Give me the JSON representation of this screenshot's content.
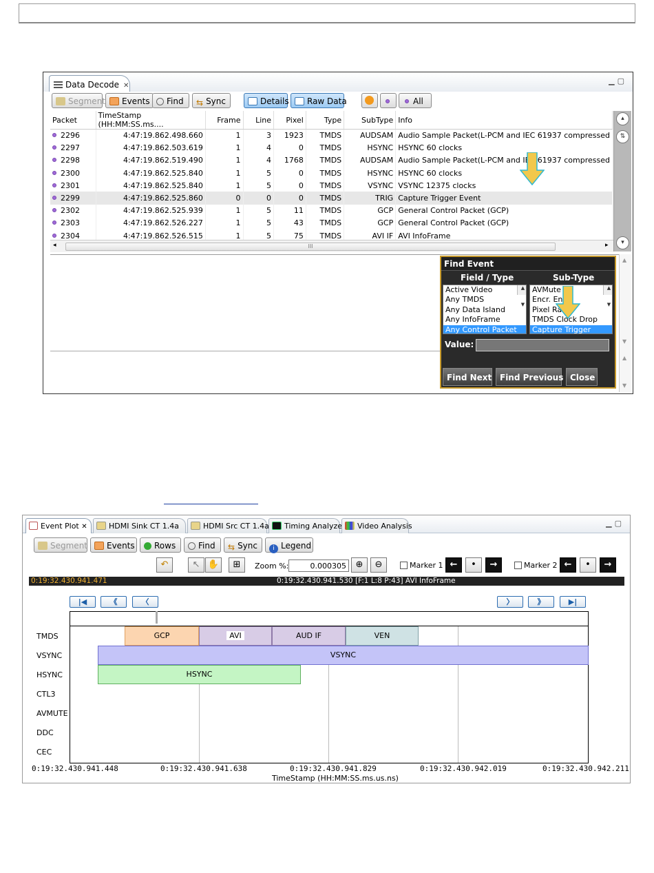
{
  "data_decode": {
    "tab_title": "Data Decode",
    "toolbar": {
      "segment": "Segment",
      "events": "Events",
      "find": "Find",
      "sync": "Sync",
      "details": "Details",
      "raw_data": "Raw Data",
      "all": "All"
    },
    "columns": [
      "Packet",
      "TimeStamp (HH:MM:SS.ms....",
      "Frame",
      "Line",
      "Pixel",
      "Type",
      "SubType",
      "Info"
    ],
    "rows": [
      {
        "packet": "2296",
        "timestamp": "4:47:19.862.498.660",
        "frame": "1",
        "line": "3",
        "pixel": "1923",
        "type": "TMDS",
        "subtype": "AUDSAM",
        "info": "Audio Sample Packet(L-PCM and IEC 61937 compressed"
      },
      {
        "packet": "2297",
        "timestamp": "4:47:19.862.503.619",
        "frame": "1",
        "line": "4",
        "pixel": "0",
        "type": "TMDS",
        "subtype": "HSYNC",
        "info": "HSYNC 60 clocks"
      },
      {
        "packet": "2298",
        "timestamp": "4:47:19.862.519.490",
        "frame": "1",
        "line": "4",
        "pixel": "1768",
        "type": "TMDS",
        "subtype": "AUDSAM",
        "info": "Audio Sample Packet(L-PCM and IEC 61937 compressed"
      },
      {
        "packet": "2300",
        "timestamp": "4:47:19.862.525.840",
        "frame": "1",
        "line": "5",
        "pixel": "0",
        "type": "TMDS",
        "subtype": "HSYNC",
        "info": "HSYNC 60 clocks"
      },
      {
        "packet": "2301",
        "timestamp": "4:47:19.862.525.840",
        "frame": "1",
        "line": "5",
        "pixel": "0",
        "type": "TMDS",
        "subtype": "VSYNC",
        "info": "VSYNC 12375 clocks"
      },
      {
        "packet": "2299",
        "timestamp": "4:47:19.862.525.860",
        "frame": "0",
        "line": "0",
        "pixel": "0",
        "type": "TMDS",
        "subtype": "TRIG",
        "info": "Capture Trigger Event"
      },
      {
        "packet": "2302",
        "timestamp": "4:47:19.862.525.939",
        "frame": "1",
        "line": "5",
        "pixel": "11",
        "type": "TMDS",
        "subtype": "GCP",
        "info": "General Control Packet (GCP)"
      },
      {
        "packet": "2303",
        "timestamp": "4:47:19.862.526.227",
        "frame": "1",
        "line": "5",
        "pixel": "43",
        "type": "TMDS",
        "subtype": "GCP",
        "info": "General Control Packet (GCP)"
      },
      {
        "packet": "2304",
        "timestamp": "4:47:19.862.526.515",
        "frame": "1",
        "line": "5",
        "pixel": "75",
        "type": "TMDS",
        "subtype": "AVI IF",
        "info": "AVI InfoFrame"
      }
    ],
    "hscroll_grip": "III"
  },
  "find_event": {
    "title": "Find Event",
    "field_type_header": "Field / Type",
    "sub_type_header": "Sub-Type",
    "field_types": [
      "Active Video",
      "Any TMDS",
      "Any Data Island",
      "Any InfoFrame",
      "Any Control Packet"
    ],
    "field_type_selected": "Any Control Packet",
    "sub_types": [
      "AVMute",
      "Encr. Ena",
      "Pixel Ratio",
      "TMDS Clock Drop",
      "Capture Trigger"
    ],
    "sub_type_selected": "Capture Trigger",
    "value_label": "Value:",
    "value": "",
    "find_next": "Find Next",
    "find_previous": "Find Previous",
    "close": "Close"
  },
  "event_plot": {
    "tabs": [
      "Event Plot",
      "HDMI Sink CT 1.4a",
      "HDMI Src CT 1.4a",
      "Timing Analyzer",
      "Video Analysis"
    ],
    "toolbar": {
      "segment": "Segment",
      "events": "Events",
      "rows": "Rows",
      "find": "Find",
      "sync": "Sync",
      "legend": "Legend",
      "zoom_label": "Zoom %:",
      "zoom_value": "0.000305",
      "marker1": "Marker 1",
      "marker2": "Marker 2"
    },
    "time_left": "0:19:32.430.941.471",
    "time_center": "0:19:32.430.941.530 [F:1 L:8 P:43] AVI InfoFrame",
    "signals": [
      "TMDS",
      "VSYNC",
      "HSYNC",
      "CTL3",
      "AVMUTE",
      "DDC",
      "CEC"
    ],
    "events": [
      {
        "label": "GCP",
        "color": "#fcd5b0",
        "border": "#e0a060"
      },
      {
        "label": "AVI",
        "color": "#d8cce6",
        "border": "#8f7aa8"
      },
      {
        "label": "AUD IF",
        "color": "#d8cce6",
        "border": "#8f7aa8"
      },
      {
        "label": "VEN",
        "color": "#cfe2e4",
        "border": "#7fa0a6"
      },
      {
        "label": "VSYNC",
        "color": "#c4c4f8",
        "border": "#7070d0"
      },
      {
        "label": "HSYNC",
        "color": "#c4f5c4",
        "border": "#60b060"
      }
    ],
    "x_ticks": [
      "0:19:32.430.941.448",
      "0:19:32.430.941.638",
      "0:19:32.430.941.829",
      "0:19:32.430.942.019",
      "0:19:32.430.942.211"
    ],
    "x_label": "TimeStamp (HH:MM:SS.ms.us.ns)"
  }
}
